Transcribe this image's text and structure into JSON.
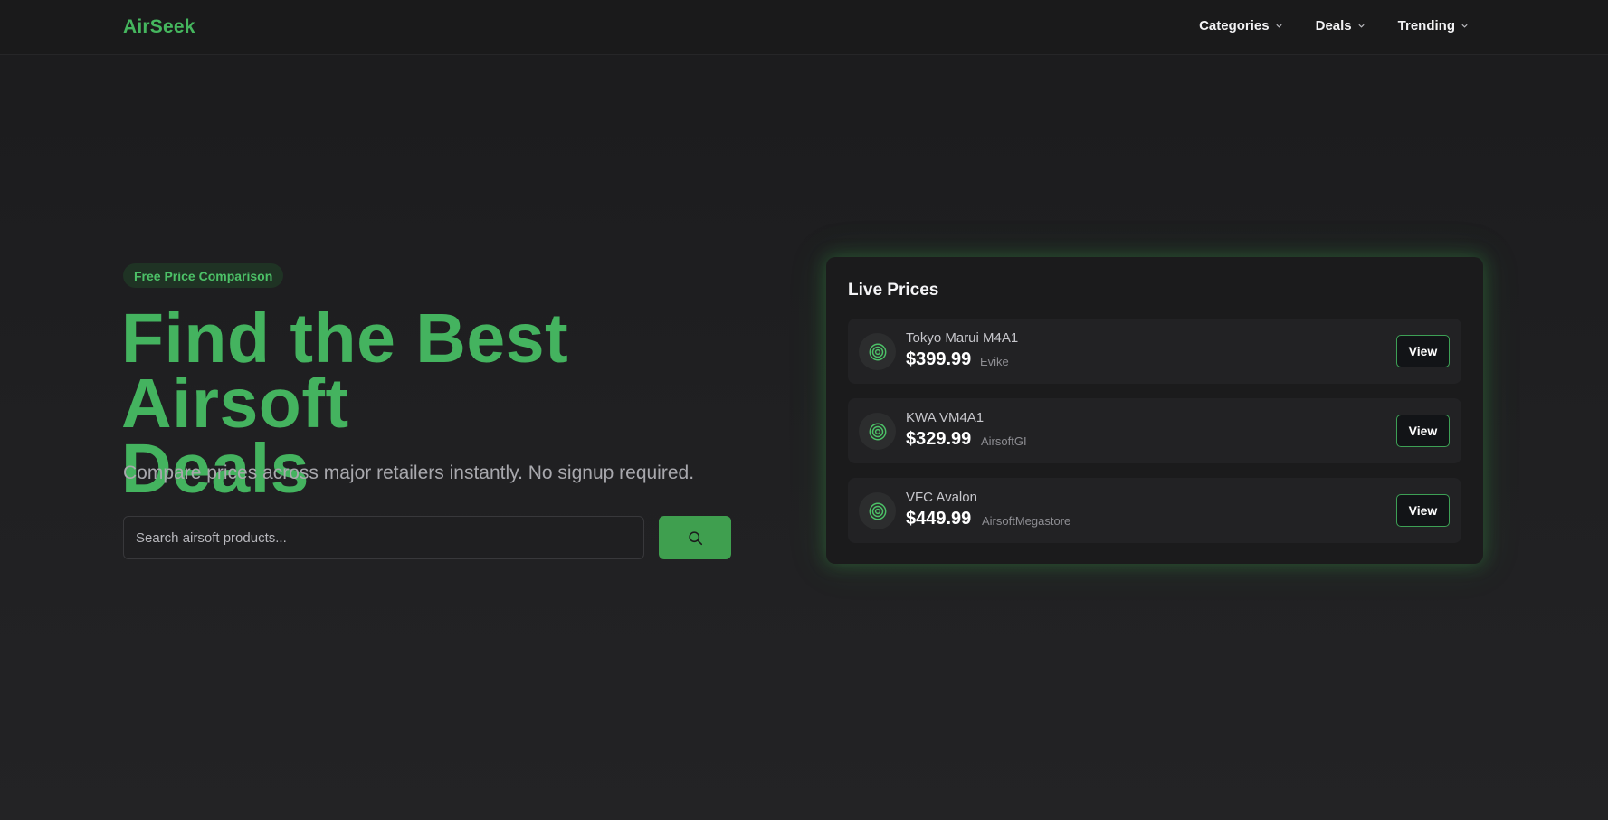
{
  "header": {
    "logo": "AirSeek",
    "nav": [
      {
        "label": "Categories"
      },
      {
        "label": "Deals"
      },
      {
        "label": "Trending"
      }
    ]
  },
  "hero": {
    "badge": "Free Price Comparison",
    "title_line1": "Find the Best Airsoft",
    "title_line2": "Deals",
    "subtitle": "Compare prices across major retailers instantly. No signup required.",
    "search": {
      "placeholder": "Search airsoft products...",
      "value": "",
      "button_icon": "search-icon"
    }
  },
  "live_prices": {
    "title": "Live Prices",
    "items": [
      {
        "name": "Tokyo Marui M4A1",
        "price": "$399.99",
        "store": "Evike",
        "button": "View",
        "icon": "target-icon"
      },
      {
        "name": "KWA VM4A1",
        "price": "$329.99",
        "store": "AirsoftGI",
        "button": "View",
        "icon": "target-icon"
      },
      {
        "name": "VFC Avalon",
        "price": "$449.99",
        "store": "AirsoftMegastore",
        "button": "View",
        "icon": "target-icon"
      }
    ]
  },
  "colors": {
    "accent": "#45b65e",
    "button_green": "#3f9f4f",
    "background": "#1d1d1f"
  }
}
